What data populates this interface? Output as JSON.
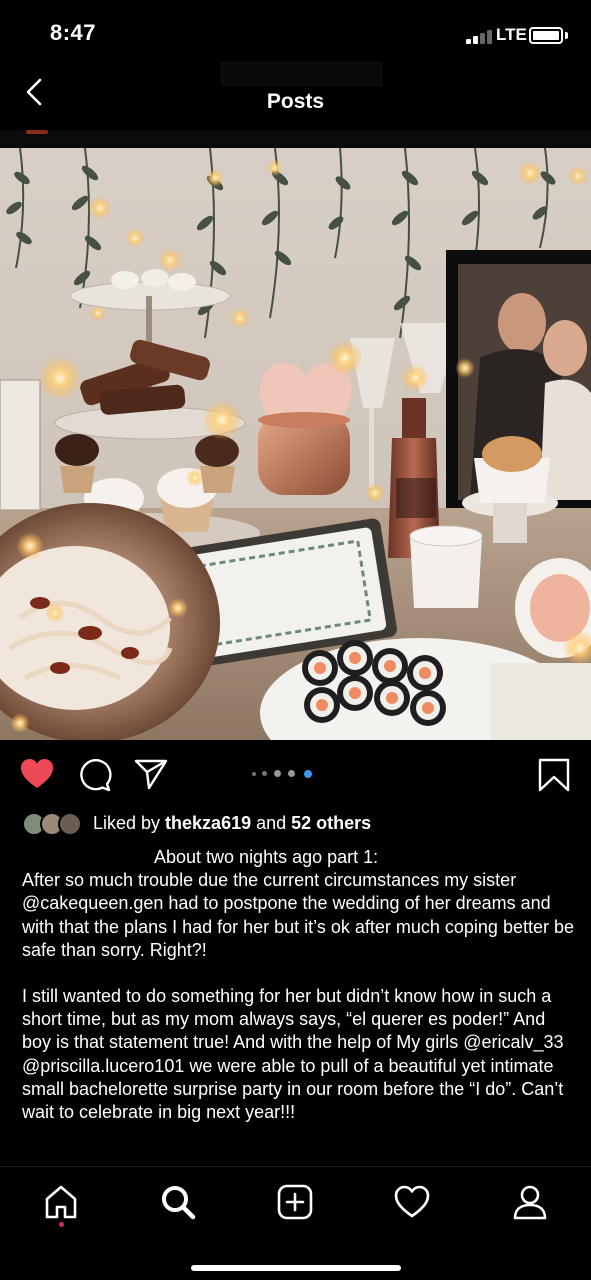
{
  "status_bar": {
    "time": "8:47",
    "network": "LTE"
  },
  "nav": {
    "title": "Posts"
  },
  "post": {
    "image_alt": "Bachelorette party table with cupcakes, sushi, champagne and fairy lights",
    "carousel": {
      "count": 5,
      "active_index": 4
    },
    "liked": true,
    "likes": {
      "prefix": "Liked by ",
      "user": "thekza619",
      "middle": " and ",
      "others": "52 others"
    },
    "caption": {
      "line_first": "About two nights ago part 1:",
      "paragraph_1": "After so much trouble due the current circumstances my sister @cakequeen.gen had to postpone the wedding of her dreams and with that the plans I had for her but it’s ok after much coping better be safe than sorry. Right?!",
      "paragraph_2": "I still wanted to do something for her but didn’t know how in such a short time, but as my mom always says, “el querer es poder!” And boy is that statement true! And with the help of My girls @ericalv_33 @priscilla.lucero101 we were able to pull of a beautiful yet intimate small bachelorette surprise party in our room before the “I do”. Can’t wait to celebrate in big next year!!!"
    }
  },
  "icons": {
    "back": "chevron-left-icon",
    "like": "heart-filled-icon",
    "comment": "comment-icon",
    "share": "paper-plane-icon",
    "save": "bookmark-icon",
    "home": "home-icon",
    "search": "search-icon",
    "create": "plus-square-icon",
    "activity": "heart-outline-icon",
    "profile": "person-icon"
  },
  "colors": {
    "like_red": "#ed4956",
    "active_dot": "#3897f0",
    "notification_dot": "#e0245e"
  }
}
